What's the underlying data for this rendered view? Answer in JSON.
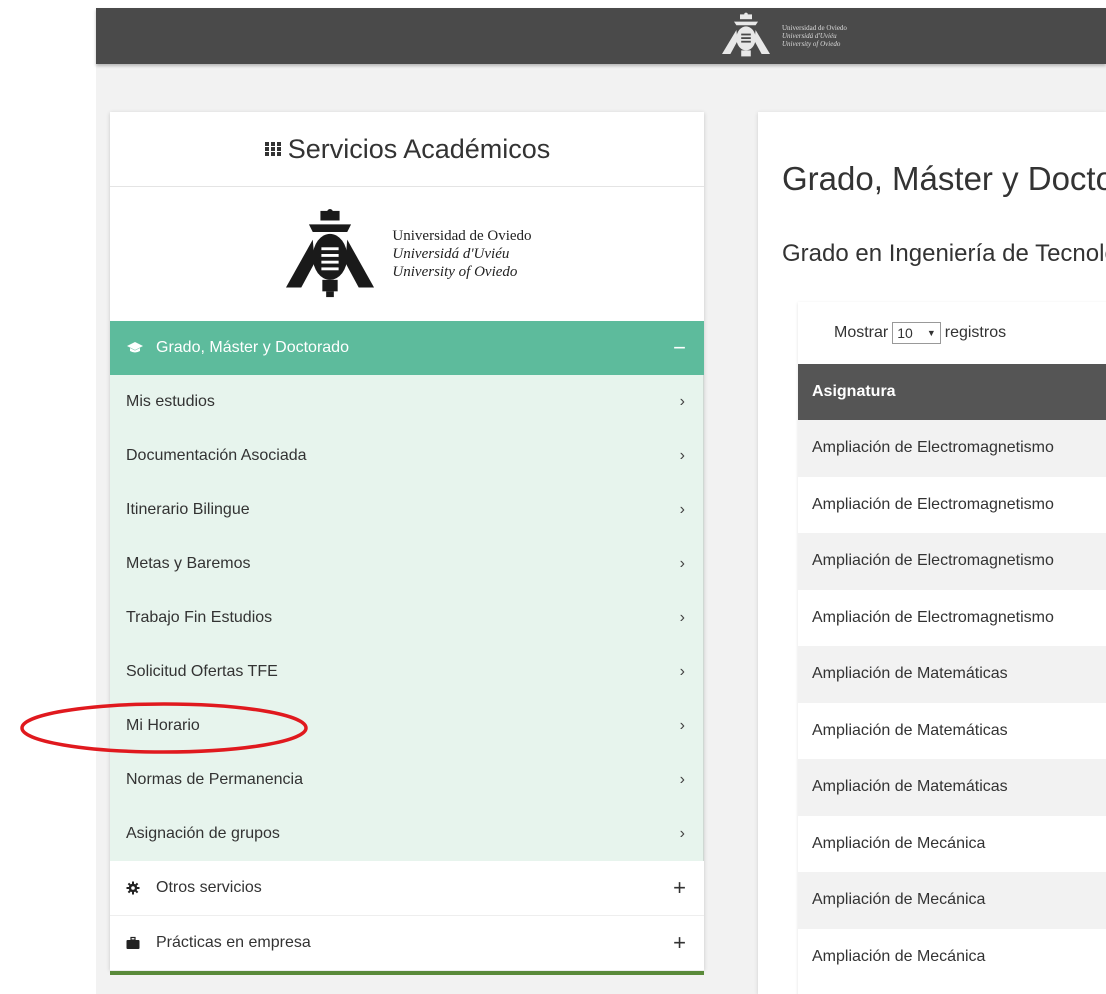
{
  "header": {
    "university_lines": [
      "Universidad de Oviedo",
      "Universidá d'Uviéu",
      "University of Oviedo"
    ]
  },
  "sidebar": {
    "title": "Servicios Académicos",
    "logo_lines": [
      "Universidad de Oviedo",
      "Universidá d'Uviéu",
      "University of Oviedo"
    ],
    "section": {
      "label": "Grado, Máster y Doctorado",
      "toggle": "−"
    },
    "items": [
      {
        "label": "Mis estudios"
      },
      {
        "label": "Documentación Asociada"
      },
      {
        "label": "Itinerario Bilingue"
      },
      {
        "label": "Metas y Baremos"
      },
      {
        "label": "Trabajo Fin Estudios"
      },
      {
        "label": "Solicitud Ofertas TFE"
      },
      {
        "label": "Mi Horario"
      },
      {
        "label": "Normas de Permanencia"
      },
      {
        "label": "Asignación de grupos"
      }
    ],
    "chevron": "›",
    "other_sections": [
      {
        "label": "Otros servicios",
        "icon": "gear-icon",
        "toggle": "+"
      },
      {
        "label": "Prácticas en empresa",
        "icon": "briefcase-icon",
        "toggle": "+"
      }
    ]
  },
  "main": {
    "title": "Grado, Máster y Doctorado",
    "subtitle": "Grado en Ingeniería de Tecnologías Industriales",
    "controls": {
      "show_label": "Mostrar",
      "page_size": "10",
      "records_label": "registros"
    },
    "table": {
      "header": "Asignatura",
      "rows": [
        "Ampliación de Electromagnetismo",
        "Ampliación de Electromagnetismo",
        "Ampliación de Electromagnetismo",
        "Ampliación de Electromagnetismo",
        "Ampliación de Matemáticas",
        "Ampliación de Matemáticas",
        "Ampliación de Matemáticas",
        "Ampliación de Mecánica",
        "Ampliación de Mecánica",
        "Ampliación de Mecánica"
      ]
    }
  },
  "colors": {
    "accent_green": "#5dbb9c",
    "submenu_bg": "#e7f4ed",
    "header_dark": "#4a4a4a",
    "annotation_red": "#e0191e"
  }
}
